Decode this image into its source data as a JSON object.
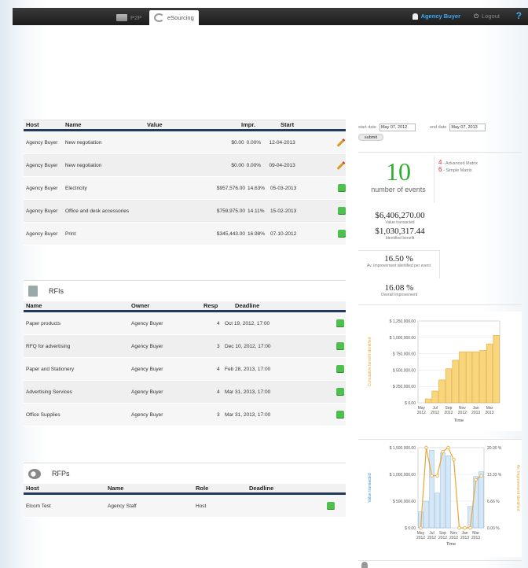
{
  "topbar": {
    "tabs": [
      {
        "label": "P2P"
      },
      {
        "label": "eSourcing"
      }
    ],
    "user": "Agency Buyer",
    "logout": "Logout",
    "help": "?"
  },
  "negotiations": {
    "headers": {
      "host": "Host",
      "name": "Name",
      "value": "Value",
      "impr": "Impr.",
      "start": "Start"
    },
    "rows": [
      {
        "host": "Agency Buyer",
        "name": "New negotiation",
        "value": "$0.00",
        "impr": "0.00%",
        "start": "12-04-2013",
        "action": "edit"
      },
      {
        "host": "Agency Buyer",
        "name": "New negotiation",
        "value": "$0.00",
        "impr": "0.00%",
        "start": "09-04-2013",
        "action": "edit"
      },
      {
        "host": "Agency Buyer",
        "name": "Electricity",
        "value": "$957,576.00",
        "impr": "14.63%",
        "start": "05-03-2013",
        "action": "open"
      },
      {
        "host": "Agency Buyer",
        "name": "Office and desk accessories",
        "value": "$759,975.00",
        "impr": "14.11%",
        "start": "15-02-2013",
        "action": "open"
      },
      {
        "host": "Agency Buyer",
        "name": "Print",
        "value": "$345,443.00",
        "impr": "16.98%",
        "start": "07-10-2012",
        "action": "open"
      }
    ]
  },
  "rfis": {
    "title": "RFIs",
    "headers": {
      "name": "Name",
      "owner": "Owner",
      "resp": "Resp",
      "deadline": "Deadline"
    },
    "rows": [
      {
        "name": "Paper products",
        "owner": "Agency Buyer",
        "resp": "4",
        "deadline": "Oct 19, 2012, 17:00"
      },
      {
        "name": "RFQ for advertising",
        "owner": "Agency Buyer",
        "resp": "3",
        "deadline": "Dec 10, 2012, 17:00"
      },
      {
        "name": "Paper and Stationery",
        "owner": "Agency Buyer",
        "resp": "4",
        "deadline": "Feb 28, 2013, 17:00"
      },
      {
        "name": "Advertising Services",
        "owner": "Agency Buyer",
        "resp": "4",
        "deadline": "Mar 31, 2013, 17:00"
      },
      {
        "name": "Office Supplies",
        "owner": "Agency Buyer",
        "resp": "3",
        "deadline": "Mar 31, 2013, 17:00"
      }
    ]
  },
  "rfps": {
    "title": "RFPs",
    "headers": {
      "host": "Host",
      "name": "Name",
      "role": "Role",
      "deadline": "Deadline"
    },
    "rows": [
      {
        "host": "Elcom Test",
        "name": "Agency Staff",
        "role": "Host",
        "deadline": ""
      }
    ]
  },
  "filters": {
    "start_label": "start date",
    "start_value": "May 07, 2012",
    "end_label": "end date",
    "end_value": "May 07, 2013",
    "submit": "submit"
  },
  "kpis": {
    "events_count": "10",
    "events_label": "number of events",
    "advanced_count": "4",
    "advanced_label": "- Advanced Matrix",
    "simple_count": "6",
    "simple_label": "- Simple Matrix",
    "value_transacted": "$6,406,270.00",
    "value_transacted_label": "Value transacted",
    "identified_benefit": "$1,030,317.44",
    "identified_benefit_label": "Identified benefit",
    "av_improvement": "16.50 %",
    "av_improvement_label": "Av. Improvement identified per event",
    "overall_improvement": "16.08 %",
    "overall_improvement_label": "Overall Improvement"
  },
  "colors": {
    "accent_green": "#2fae2f",
    "bar_orange": "#f5c24c",
    "line_orange": "#e8a533",
    "bar_blue": "#cfe4f6",
    "link_blue": "#3fa9f5",
    "navy": "#243a5a"
  },
  "chart_data": [
    {
      "type": "bar",
      "ylabel": "Cumulative benefit identified",
      "xlabel": "Time",
      "x_ticks": [
        "May 2012",
        "Jul 2012",
        "Sep 2012",
        "Nov 2012",
        "Jan 2013",
        "Mar 2013"
      ],
      "y_ticks": [
        "$ 1,250,000.00",
        "$ 1,000,000.00",
        "$ 750,000.00",
        "$ 500,000.00",
        "$ 250,000.00",
        "$ 0.00"
      ],
      "ylim": [
        0,
        1250000
      ],
      "values": [
        0,
        60000,
        180000,
        350000,
        520000,
        650000,
        780000,
        780000,
        780000,
        800000,
        900000,
        1030000
      ]
    },
    {
      "type": "bar+line",
      "ylabel": "Value transacted",
      "y2label": "Av. Improvement identified",
      "xlabel": "Time",
      "x_ticks": [
        "May 2012",
        "Jul 2012",
        "Sep 2012",
        "Nov 2012",
        "Jan 2013",
        "Mar 2013"
      ],
      "y_ticks": [
        "$ 1,500,000.00",
        "$ 1,000,000.00",
        "$ 500,000.00",
        "$ 0.00"
      ],
      "y2_ticks": [
        "20.00 %",
        "13.33 %",
        "6.66 %",
        "0.00 %"
      ],
      "ylim": [
        0,
        1500000
      ],
      "y2lim": [
        0,
        20
      ],
      "bar_values": [
        300000,
        500000,
        1450000,
        650000,
        1400000,
        1350000,
        0,
        0,
        0,
        400000,
        960000,
        1050000
      ],
      "line_values": [
        0,
        20,
        13,
        13,
        19,
        20,
        17,
        0,
        0,
        0,
        12,
        13
      ]
    }
  ]
}
